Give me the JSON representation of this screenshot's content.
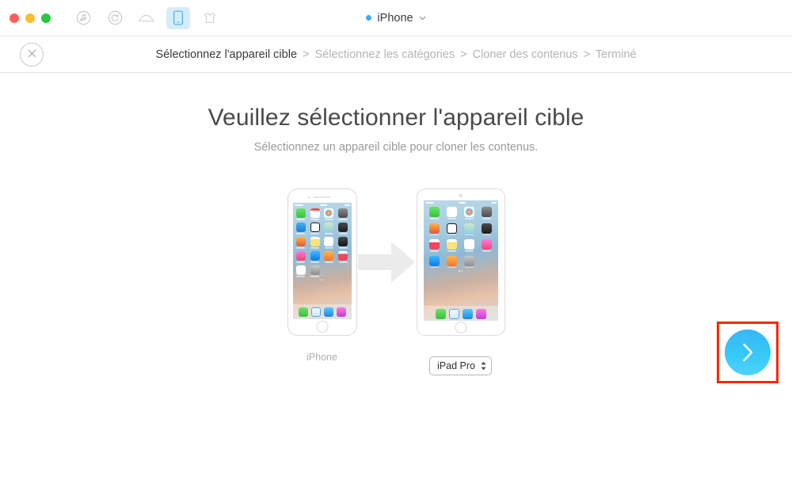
{
  "window": {
    "title": "iPhone",
    "title_status_dot_color": "#3fa9f5",
    "title_chevron": "⌄",
    "traffic_lights": [
      {
        "name": "close",
        "color": "#ff5f57"
      },
      {
        "name": "minimize",
        "color": "#febc2e"
      },
      {
        "name": "maximize",
        "color": "#28c840"
      }
    ],
    "toolbar_icons": [
      {
        "name": "music-icon",
        "label": "Musique",
        "active": false
      },
      {
        "name": "refresh-icon",
        "label": "Restaurer",
        "active": false
      },
      {
        "name": "cloud-icon",
        "label": "iCloud",
        "active": false
      },
      {
        "name": "phone-device-icon",
        "label": "Appareil",
        "active": true
      },
      {
        "name": "toolkit-icon",
        "label": "Boîte à outils",
        "active": false
      }
    ]
  },
  "breadcrumb": {
    "close_label": "×",
    "separator": ">",
    "steps": [
      {
        "label": "Sélectionnez l'appareil cible",
        "state": "current"
      },
      {
        "label": "Sélectionnez les catégories",
        "state": "upcoming"
      },
      {
        "label": "Cloner des contenus",
        "state": "upcoming"
      },
      {
        "label": "Terminé",
        "state": "upcoming"
      }
    ]
  },
  "main": {
    "headline": "Veuillez sélectionner l'appareil cible",
    "subtitle": "Sélectionnez un appareil cible pour cloner les contenus.",
    "source_device": {
      "name": "iPhone",
      "type": "iphone"
    },
    "transfer_arrow": "arrow-right-icon",
    "target_device": {
      "selected": "iPad Pro",
      "options": [
        "iPad Pro"
      ],
      "type": "ipad"
    },
    "next_button": {
      "name": "next-button",
      "glyph": "›",
      "highlight_color": "#ff2600",
      "fill_top": "#39b6f5",
      "fill_bottom": "#4fd3f8"
    }
  },
  "home_screen": {
    "phone_apps": [
      {
        "name": "Messages",
        "class": "i-messages"
      },
      {
        "name": "Calendrier",
        "class": "i-calendar"
      },
      {
        "name": "Photos",
        "class": "i-photos"
      },
      {
        "name": "Appareil photo",
        "class": "i-camera"
      },
      {
        "name": "Météo",
        "class": "i-weather"
      },
      {
        "name": "Horloge",
        "class": "i-clock"
      },
      {
        "name": "Plans",
        "class": "i-maps"
      },
      {
        "name": "Vidéos",
        "class": "i-videos"
      },
      {
        "name": "Wallet",
        "class": "i-wallet"
      },
      {
        "name": "Notes",
        "class": "i-notes"
      },
      {
        "name": "Rappels",
        "class": "i-remind"
      },
      {
        "name": "Bourse",
        "class": "i-stocks"
      },
      {
        "name": "Musique",
        "class": "i-music"
      },
      {
        "name": "App Store",
        "class": "i-appstore"
      },
      {
        "name": "iBooks",
        "class": "i-ibooks"
      },
      {
        "name": "News",
        "class": "i-news"
      },
      {
        "name": "Santé",
        "class": "i-health"
      },
      {
        "name": "Réglages",
        "class": "i-settings"
      }
    ],
    "phone_dock": [
      {
        "name": "Téléphone",
        "class": "i-phone"
      },
      {
        "name": "Safari",
        "class": "i-safari"
      },
      {
        "name": "Mail",
        "class": "i-mail"
      },
      {
        "name": "Musique",
        "class": "i-itunes"
      }
    ],
    "pad_apps": [
      {
        "name": "FaceTime",
        "class": "i-facetime"
      },
      {
        "name": "Calendrier",
        "class": "i-cal2"
      },
      {
        "name": "Photos",
        "class": "i-photos"
      },
      {
        "name": "Appareil photo",
        "class": "i-camera"
      },
      {
        "name": "Contacts",
        "class": "i-wallet"
      },
      {
        "name": "Horloge",
        "class": "i-clock"
      },
      {
        "name": "Plans",
        "class": "i-maps"
      },
      {
        "name": "Vidéos",
        "class": "i-videos"
      },
      {
        "name": "Photo Booth",
        "class": "i-news"
      },
      {
        "name": "Notes",
        "class": "i-notes"
      },
      {
        "name": "Rappels",
        "class": "i-remind"
      },
      {
        "name": "Musique",
        "class": "i-music"
      },
      {
        "name": "App Store",
        "class": "i-appstore"
      },
      {
        "name": "iBooks",
        "class": "i-ibooks"
      },
      {
        "name": "Réglages",
        "class": "i-settings"
      }
    ],
    "pad_dock": [
      {
        "name": "Messages",
        "class": "i-messages"
      },
      {
        "name": "Safari",
        "class": "i-safari"
      },
      {
        "name": "Mail",
        "class": "i-mail"
      },
      {
        "name": "Musique",
        "class": "i-itunes"
      }
    ]
  }
}
